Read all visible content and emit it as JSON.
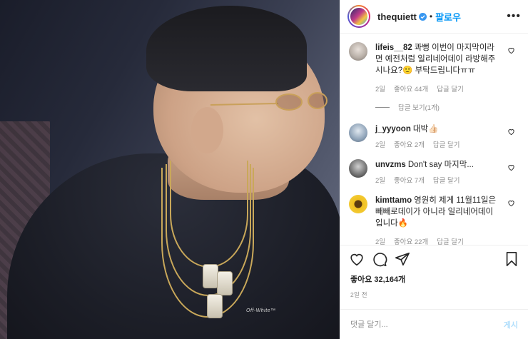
{
  "header": {
    "username": "thequiett",
    "separator": "•",
    "follow_label": "팔로우",
    "more_label": "•••",
    "verified_icon": "verified-badge-icon"
  },
  "comments": [
    {
      "user": "lifeis__82",
      "text": "콰뻥 이번이 마지막이라면 예전처럼 일리네어데이 라방해주시나요?🙂 부탁드립니다ㅠㅠ",
      "time": "2일",
      "likes": "좋아요 44개",
      "reply": "답글 달기",
      "replies": "답글 보기(1개)",
      "avatar_color": "#b9b0a8"
    },
    {
      "user": "j_yyyoon",
      "text": "대박👍🏻",
      "time": "2일",
      "likes": "좋아요 2개",
      "reply": "답글 달기",
      "avatar_color": "#8fa3b8"
    },
    {
      "user": "unvzms",
      "text": "Don't say 마지막...",
      "time": "2일",
      "likes": "좋아요 7개",
      "reply": "답글 달기",
      "avatar_color": "#6e6e6e"
    },
    {
      "user": "kimttamo",
      "text": "영원히 제게 11월11일은 빼빼로데이가 아니라 일리네어데이입니다🔥",
      "time": "2일",
      "likes": "좋아요 22개",
      "reply": "답글 달기",
      "avatar_color": "#f0c020"
    }
  ],
  "actions": {
    "like_icon": "heart-icon",
    "comment_icon": "comment-icon",
    "share_icon": "share-icon",
    "save_icon": "bookmark-icon"
  },
  "likes_text": "좋아요 32,164개",
  "time_text": "2일 전",
  "add_comment": {
    "placeholder": "댓글 달기...",
    "post_label": "게시"
  },
  "photo": {
    "shirt_text": "Off-White™"
  }
}
